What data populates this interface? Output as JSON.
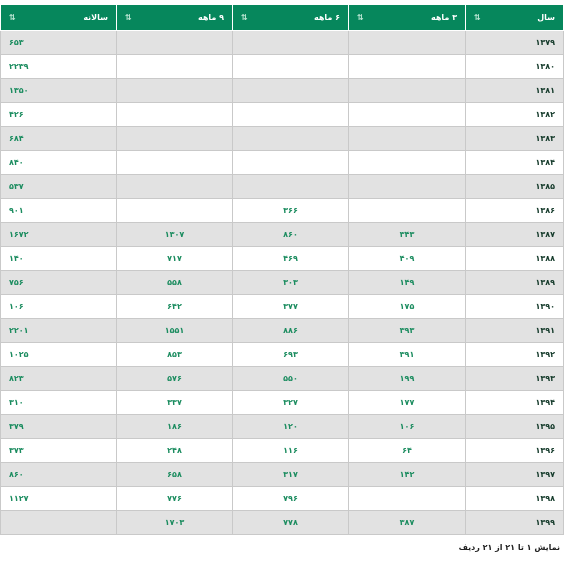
{
  "table": {
    "columns": [
      {
        "key": "year",
        "label": "سال",
        "sort_icon": "sort-asc-icon"
      },
      {
        "key": "m3",
        "label": "۳ ماهه",
        "sort_icon": "sort-icon"
      },
      {
        "key": "m6",
        "label": "۶ ماهه",
        "sort_icon": "sort-icon"
      },
      {
        "key": "m9",
        "label": "۹ ماهه",
        "sort_icon": "sort-icon"
      },
      {
        "key": "annual",
        "label": "سالانه",
        "sort_icon": "sort-icon"
      }
    ],
    "rows": [
      {
        "year": "۱۳۷۹",
        "m3": "",
        "m6": "",
        "m9": "",
        "annual": "۶۵۳"
      },
      {
        "year": "۱۳۸۰",
        "m3": "",
        "m6": "",
        "m9": "",
        "annual": "۲۲۳۹"
      },
      {
        "year": "۱۳۸۱",
        "m3": "",
        "m6": "",
        "m9": "",
        "annual": "۱۳۵۰"
      },
      {
        "year": "۱۳۸۲",
        "m3": "",
        "m6": "",
        "m9": "",
        "annual": "۴۲۶"
      },
      {
        "year": "۱۳۸۳",
        "m3": "",
        "m6": "",
        "m9": "",
        "annual": "۶۸۴"
      },
      {
        "year": "۱۳۸۴",
        "m3": "",
        "m6": "",
        "m9": "",
        "annual": "۸۴۰"
      },
      {
        "year": "۱۳۸۵",
        "m3": "",
        "m6": "",
        "m9": "",
        "annual": "۵۳۷"
      },
      {
        "year": "۱۳۸۶",
        "m3": "",
        "m6": "۳۶۶",
        "m9": "",
        "annual": "۹۰۱"
      },
      {
        "year": "۱۳۸۷",
        "m3": "۳۴۳",
        "m6": "۸۶۰",
        "m9": "۱۳۰۷",
        "annual": "۱۶۷۲"
      },
      {
        "year": "۱۳۸۸",
        "m3": "۴۰۹",
        "m6": "۴۶۹",
        "m9": "۷۱۷",
        "annual": "۱۴۰"
      },
      {
        "year": "۱۳۸۹",
        "m3": "۱۴۹",
        "m6": "۳۰۳",
        "m9": "۵۵۸",
        "annual": "۷۵۶"
      },
      {
        "year": "۱۳۹۰",
        "m3": "۱۷۵",
        "m6": "۳۷۷",
        "m9": "۶۴۲",
        "annual": "۱۰۶"
      },
      {
        "year": "۱۳۹۱",
        "m3": "۳۹۳",
        "m6": "۸۸۶",
        "m9": "۱۵۵۱",
        "annual": "۲۲۰۱"
      },
      {
        "year": "۱۳۹۲",
        "m3": "۳۹۱",
        "m6": "۶۹۳",
        "m9": "۸۵۳",
        "annual": "۱۰۲۵"
      },
      {
        "year": "۱۳۹۳",
        "m3": "۱۹۹",
        "m6": "۵۵۰",
        "m9": "۵۷۶",
        "annual": "۸۲۳"
      },
      {
        "year": "۱۳۹۴",
        "m3": "۱۷۷",
        "m6": "۳۲۷",
        "m9": "۳۳۷",
        "annual": "۳۱۰"
      },
      {
        "year": "۱۳۹۵",
        "m3": "۱۰۶",
        "m6": "۱۲۰",
        "m9": "۱۸۶",
        "annual": "۳۷۹"
      },
      {
        "year": "۱۳۹۶",
        "m3": "۶۴",
        "m6": "۱۱۶",
        "m9": "۲۴۸",
        "annual": "۳۷۳"
      },
      {
        "year": "۱۳۹۷",
        "m3": "۱۴۲",
        "m6": "۳۱۷",
        "m9": "۶۵۸",
        "annual": "۸۶۰"
      },
      {
        "year": "۱۳۹۸",
        "m3": "",
        "m6": "۷۹۶",
        "m9": "۷۷۶",
        "annual": "۱۱۲۷"
      },
      {
        "year": "۱۳۹۹",
        "m3": "۳۸۷",
        "m6": "۷۷۸",
        "m9": "۱۷۰۳",
        "annual": ""
      }
    ]
  },
  "footer": {
    "info": "نمایش ۱ تا ۲۱ از ۲۱ ردیف"
  },
  "colors": {
    "header_bg": "#06875c",
    "value_text": "#1b8c5f",
    "row_alt": "#e2e2e2"
  }
}
